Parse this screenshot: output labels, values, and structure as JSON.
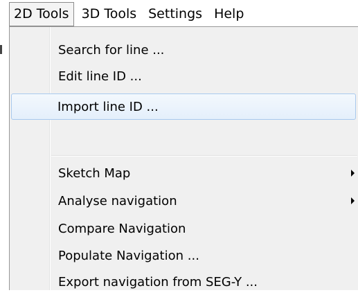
{
  "menubar": {
    "items": [
      {
        "label": "2D Tools",
        "active": true
      },
      {
        "label": "3D Tools",
        "active": false
      },
      {
        "label": "Settings",
        "active": false
      },
      {
        "label": "Help",
        "active": false
      }
    ]
  },
  "dropdown": {
    "group1": [
      {
        "label": "Search for line ..."
      },
      {
        "label": "Edit line ID ..."
      },
      {
        "label": "Import line ID ...",
        "highlighted": true
      }
    ],
    "group2": [
      {
        "label": "Sketch Map",
        "submenu": true
      },
      {
        "label": "Analyse navigation",
        "submenu": true
      },
      {
        "label": "Compare Navigation"
      },
      {
        "label": "Populate Navigation ..."
      },
      {
        "label": "Export navigation from SEG-Y ..."
      }
    ]
  },
  "colors": {
    "highlight_border": "#a8c9ee",
    "menu_background": "#f0f0f0"
  }
}
